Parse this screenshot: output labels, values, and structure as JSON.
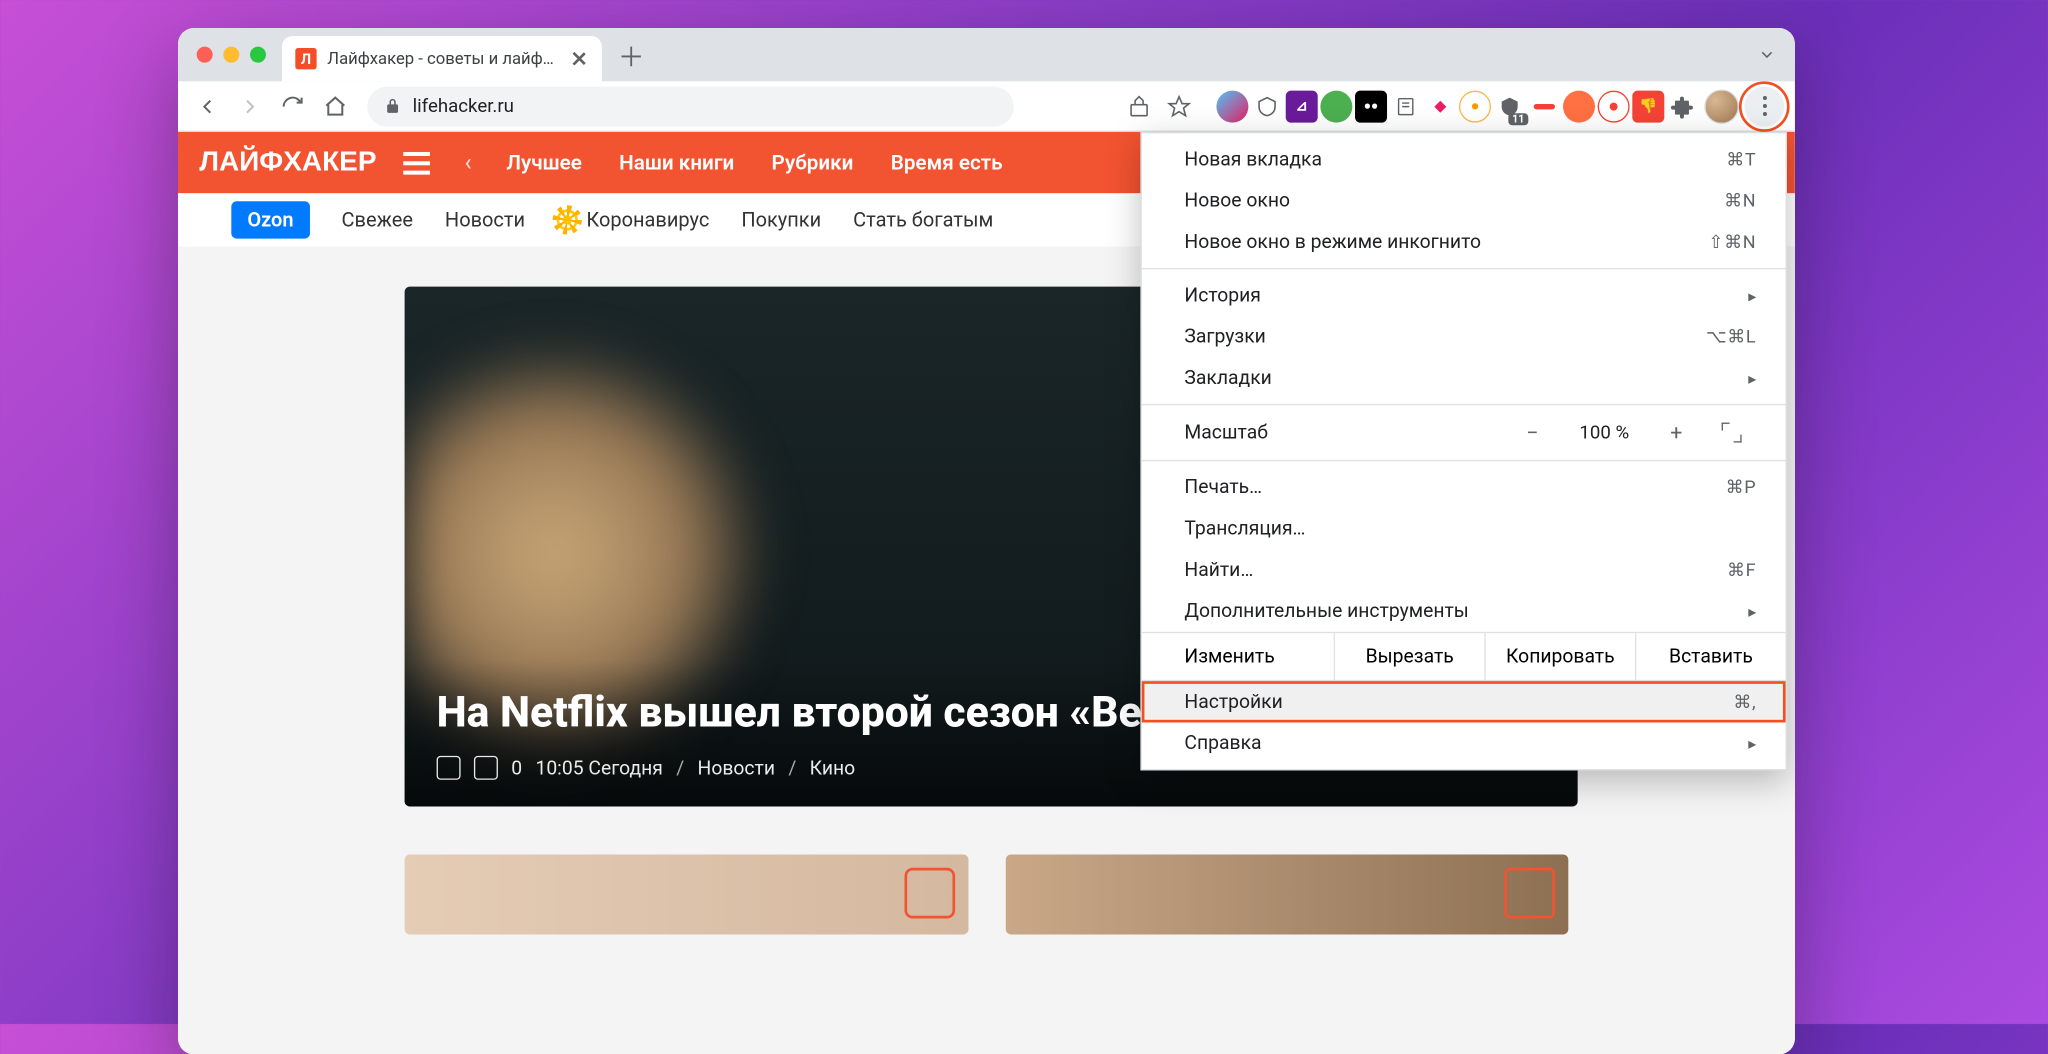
{
  "tab": {
    "title": "Лайфхакер - советы и лайфха",
    "favicon_letter": "Л"
  },
  "toolbar": {
    "url": "lifehacker.ru"
  },
  "site": {
    "logo": "ЛАЙФХАКЕР",
    "nav": [
      "Лучшее",
      "Наши книги",
      "Рубрики",
      "Время есть"
    ],
    "subnav": {
      "pill": "Ozon",
      "items": [
        "Свежее",
        "Новости",
        "Коронавирус",
        "Покупки",
        "Стать богатым"
      ]
    }
  },
  "hero": {
    "title": "На Netflix вышел второй сезон «Ведьмака»",
    "comments": "0",
    "time": "10:05 Сегодня",
    "cat1": "Новости",
    "cat2": "Кино"
  },
  "menu": {
    "new_tab": {
      "label": "Новая вкладка",
      "shortcut": "⌘T"
    },
    "new_window": {
      "label": "Новое окно",
      "shortcut": "⌘N"
    },
    "incognito": {
      "label": "Новое окно в режиме инкогнито",
      "shortcut": "⇧⌘N"
    },
    "history": {
      "label": "История"
    },
    "downloads": {
      "label": "Загрузки",
      "shortcut": "⌥⌘L"
    },
    "bookmarks": {
      "label": "Закладки"
    },
    "zoom": {
      "label": "Масштаб",
      "minus": "−",
      "value": "100 %",
      "plus": "+"
    },
    "print": {
      "label": "Печать…",
      "shortcut": "⌘P"
    },
    "cast": {
      "label": "Трансляция…"
    },
    "find": {
      "label": "Найти…",
      "shortcut": "⌘F"
    },
    "more_tools": {
      "label": "Дополнительные инструменты"
    },
    "edit": {
      "label": "Изменить",
      "cut": "Вырезать",
      "copy": "Копировать",
      "paste": "Вставить"
    },
    "settings": {
      "label": "Настройки",
      "shortcut": "⌘,"
    },
    "help": {
      "label": "Справка"
    }
  },
  "ext_badge": "11"
}
